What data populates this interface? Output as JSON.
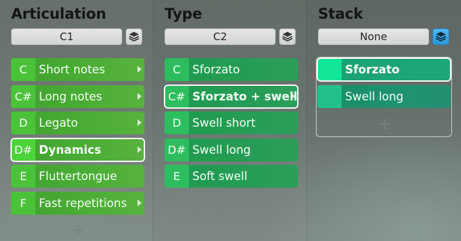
{
  "columns": [
    {
      "title": "Articulation",
      "selector": "C1",
      "items": [
        {
          "key": "C",
          "label": "Short notes",
          "arrow": true,
          "selected": false
        },
        {
          "key": "C#",
          "label": "Long notes",
          "arrow": true,
          "selected": false
        },
        {
          "key": "D",
          "label": "Legato",
          "arrow": true,
          "selected": false
        },
        {
          "key": "D#",
          "label": "Dynamics",
          "arrow": true,
          "selected": true
        },
        {
          "key": "E",
          "label": "Fluttertongue",
          "arrow": false,
          "selected": false
        },
        {
          "key": "F",
          "label": "Fast repetitions",
          "arrow": true,
          "selected": false
        }
      ],
      "add_label": "+"
    },
    {
      "title": "Type",
      "selector": "C2",
      "items": [
        {
          "key": "C",
          "label": "Sforzato",
          "arrow": false,
          "selected": false
        },
        {
          "key": "C#",
          "label": "Sforzato + swell",
          "arrow": true,
          "selected": true
        },
        {
          "key": "D",
          "label": "Swell short",
          "arrow": false,
          "selected": false
        },
        {
          "key": "D#",
          "label": "Swell long",
          "arrow": false,
          "selected": false
        },
        {
          "key": "E",
          "label": "Soft swell",
          "arrow": false,
          "selected": false
        }
      ],
      "add_label": "+"
    },
    {
      "title": "Stack",
      "selector": "None",
      "items": [
        {
          "label": "Sforzato",
          "top": true
        },
        {
          "label": "Swell long",
          "top": false
        }
      ],
      "add_label": "+"
    }
  ],
  "icons": {
    "stack_button": "stack-layers-icon",
    "submenu": "chevron-right-icon",
    "add": "plus-icon"
  },
  "colors": {
    "articulation": "#4cae36",
    "type": "#259c55",
    "stack_top": "#13e596",
    "stack_active": "#2a97d9"
  }
}
